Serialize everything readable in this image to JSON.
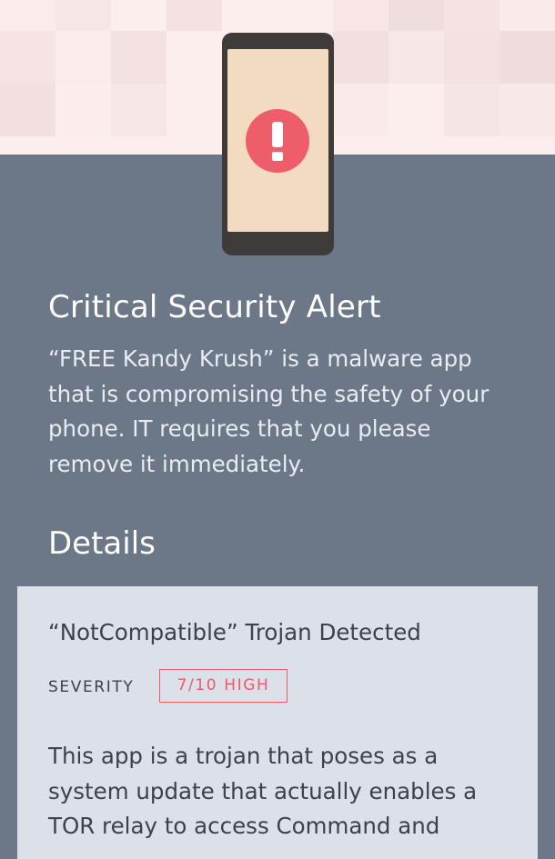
{
  "alert": {
    "title": "Critical Security Alert",
    "description": "“FREE Kandy Krush” is a malware app that is compromising the safety of your phone. IT requires that you please remove it immediately.",
    "icon": "exclamation-icon"
  },
  "details": {
    "heading": "Details",
    "threat_name": "“NotCompatible” Trojan Detected",
    "severity_label": "SEVERITY",
    "severity_value": "7/10  HIGH",
    "threat_description": "This app is a trojan that poses as a system update that actually enables a TOR relay to access Command and"
  },
  "colors": {
    "background": "#6c7888",
    "hero": "#fdeeee",
    "card": "#dce0e8",
    "danger": "#ee5a6a",
    "phone_body": "#3f3b3b",
    "phone_screen": "#f3dbc2"
  }
}
